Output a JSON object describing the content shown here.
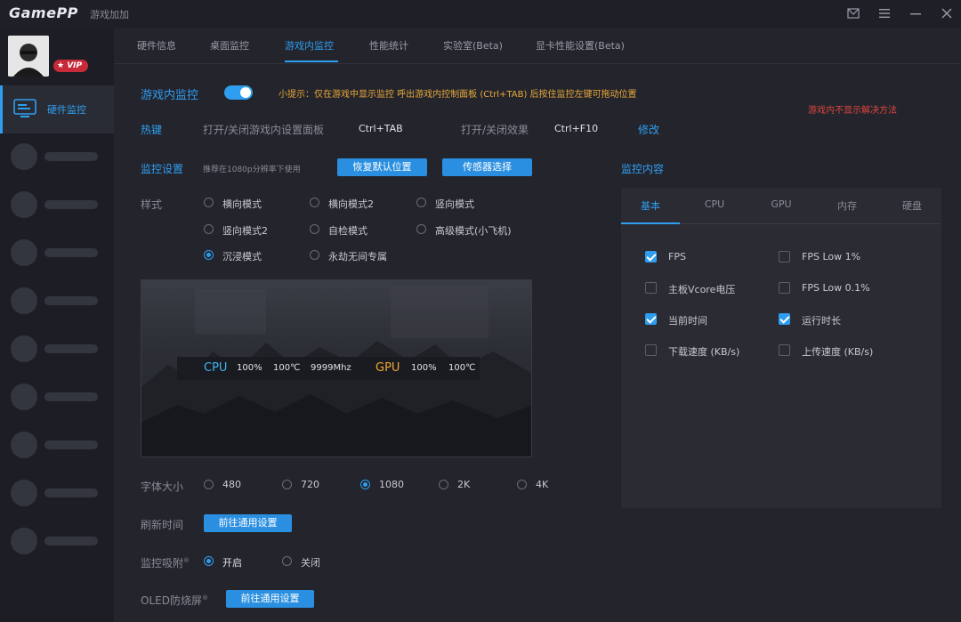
{
  "app": {
    "logo": "GamePP",
    "subtitle": "游戏加加"
  },
  "vip": "VIP",
  "sidebar": {
    "active_label": "硬件监控"
  },
  "tabs": [
    "硬件信息",
    "桌面监控",
    "游戏内监控",
    "性能统计",
    "实验室(Beta)",
    "显卡性能设置(Beta)"
  ],
  "ingame": {
    "title": "游戏内监控",
    "toggle_on": true,
    "tip": "小提示：仅在游戏中显示监控 呼出游戏内控制面板 (Ctrl+TAB) 后按住监控左键可拖动位置",
    "help_link": "游戏内不显示解决方法"
  },
  "hotkey": {
    "label": "热键",
    "panel_label": "打开/关闭游戏内设置面板",
    "panel_key": "Ctrl+TAB",
    "effect_label": "打开/关闭效果",
    "effect_key": "Ctrl+F10",
    "modify": "修改"
  },
  "monitor_settings": {
    "label": "监控设置",
    "hint": "推荐在1080p分辨率下使用",
    "reset_btn": "恢复默认位置",
    "sensor_btn": "传感器选择"
  },
  "monitor_content_label": "监控内容",
  "style": {
    "label": "样式",
    "options": [
      "横向模式",
      "横向模式2",
      "竖向模式",
      "竖向模式2",
      "自检模式",
      "高级模式(小飞机)",
      "沉浸模式",
      "永劫无间专属"
    ],
    "selected": "沉浸模式"
  },
  "preview": {
    "cpu_label": "CPU",
    "cpu_usage": "100%",
    "cpu_temp": "100℃",
    "cpu_freq": "9999Mhz",
    "gpu_label": "GPU",
    "gpu_usage": "100%",
    "gpu_temp": "100℃"
  },
  "font_size": {
    "label": "字体大小",
    "options": [
      "480",
      "720",
      "1080",
      "2K",
      "4K"
    ],
    "selected": "1080"
  },
  "refresh": {
    "label": "刷新时间",
    "btn": "前往通用设置"
  },
  "snap": {
    "label": "监控吸附",
    "mark": "®",
    "options": [
      "开启",
      "关闭"
    ],
    "selected": "开启"
  },
  "oled": {
    "label": "OLED防烧屏",
    "mark": "®",
    "btn": "前往通用设置"
  },
  "panel": {
    "tabs": [
      "基本",
      "CPU",
      "GPU",
      "内存",
      "硬盘"
    ],
    "active_tab": "基本",
    "items": [
      {
        "label": "FPS",
        "checked": true
      },
      {
        "label": "FPS Low 1%",
        "checked": false
      },
      {
        "label": "主板Vcore电压",
        "checked": false
      },
      {
        "label": "FPS Low 0.1%",
        "checked": false
      },
      {
        "label": "当前时间",
        "checked": true
      },
      {
        "label": "运行时长",
        "checked": true
      },
      {
        "label": "下载速度 (KB/s)",
        "checked": false
      },
      {
        "label": "上传速度 (KB/s)",
        "checked": false
      }
    ]
  },
  "colors": {
    "accent": "#2f9ef0",
    "tip": "#e8a93a",
    "warning": "#e0463f",
    "cpu": "#3fb4f0",
    "gpu": "#f0a62e"
  }
}
